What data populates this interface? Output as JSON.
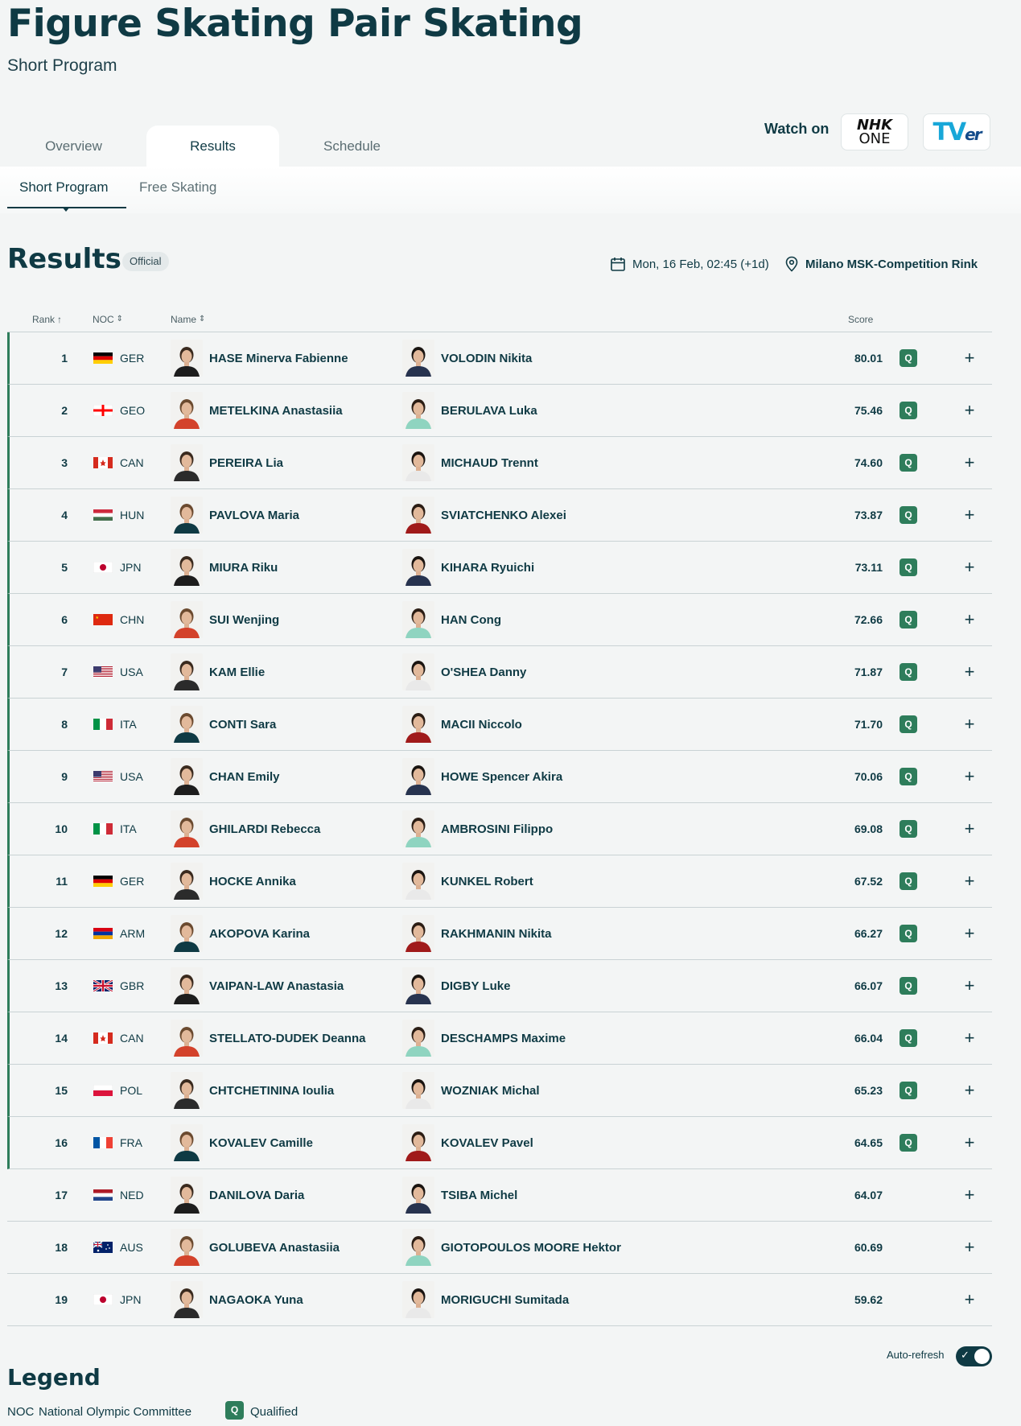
{
  "header": {
    "title": "Figure Skating Pair Skating",
    "subtitle": "Short Program"
  },
  "tabs": [
    {
      "label": "Overview"
    },
    {
      "label": "Results"
    },
    {
      "label": "Schedule"
    }
  ],
  "watch": {
    "label": "Watch on",
    "providers": [
      {
        "line1": "NHK",
        "line2": "ONE"
      },
      {
        "brand": "TV",
        "suffix": "er"
      }
    ]
  },
  "subtabs": [
    {
      "label": "Short Program"
    },
    {
      "label": "Free Skating"
    }
  ],
  "results": {
    "heading": "Results",
    "badge": "Official",
    "datetime": "Mon, 16 Feb, 02:45 (+1d)",
    "venue": "Milano MSK-Competition Rink"
  },
  "columns": {
    "rank": "Rank",
    "noc": "NOC",
    "name": "Name",
    "score": "Score"
  },
  "rows": [
    {
      "rank": "1",
      "noc": "GER",
      "skater1": "HASE Minerva Fabienne",
      "skater2": "VOLODIN Nikita",
      "score": "80.01",
      "q": "Q"
    },
    {
      "rank": "2",
      "noc": "GEO",
      "skater1": "METELKINA Anastasiia",
      "skater2": "BERULAVA Luka",
      "score": "75.46",
      "q": "Q"
    },
    {
      "rank": "3",
      "noc": "CAN",
      "skater1": "PEREIRA Lia",
      "skater2": "MICHAUD Trennt",
      "score": "74.60",
      "q": "Q"
    },
    {
      "rank": "4",
      "noc": "HUN",
      "skater1": "PAVLOVA Maria",
      "skater2": "SVIATCHENKO Alexei",
      "score": "73.87",
      "q": "Q"
    },
    {
      "rank": "5",
      "noc": "JPN",
      "skater1": "MIURA Riku",
      "skater2": "KIHARA Ryuichi",
      "score": "73.11",
      "q": "Q"
    },
    {
      "rank": "6",
      "noc": "CHN",
      "skater1": "SUI Wenjing",
      "skater2": "HAN Cong",
      "score": "72.66",
      "q": "Q"
    },
    {
      "rank": "7",
      "noc": "USA",
      "skater1": "KAM Ellie",
      "skater2": "O'SHEA Danny",
      "score": "71.87",
      "q": "Q"
    },
    {
      "rank": "8",
      "noc": "ITA",
      "skater1": "CONTI Sara",
      "skater2": "MACII Niccolo",
      "score": "71.70",
      "q": "Q"
    },
    {
      "rank": "9",
      "noc": "USA",
      "skater1": "CHAN Emily",
      "skater2": "HOWE Spencer Akira",
      "score": "70.06",
      "q": "Q"
    },
    {
      "rank": "10",
      "noc": "ITA",
      "skater1": "GHILARDI Rebecca",
      "skater2": "AMBROSINI Filippo",
      "score": "69.08",
      "q": "Q"
    },
    {
      "rank": "11",
      "noc": "GER",
      "skater1": "HOCKE Annika",
      "skater2": "KUNKEL Robert",
      "score": "67.52",
      "q": "Q"
    },
    {
      "rank": "12",
      "noc": "ARM",
      "skater1": "AKOPOVA Karina",
      "skater2": "RAKHMANIN Nikita",
      "score": "66.27",
      "q": "Q"
    },
    {
      "rank": "13",
      "noc": "GBR",
      "skater1": "VAIPAN-LAW Anastasia",
      "skater2": "DIGBY Luke",
      "score": "66.07",
      "q": "Q"
    },
    {
      "rank": "14",
      "noc": "CAN",
      "skater1": "STELLATO-DUDEK Deanna",
      "skater2": "DESCHAMPS Maxime",
      "score": "66.04",
      "q": "Q"
    },
    {
      "rank": "15",
      "noc": "POL",
      "skater1": "CHTCHETININA Ioulia",
      "skater2": "WOZNIAK Michal",
      "score": "65.23",
      "q": "Q"
    },
    {
      "rank": "16",
      "noc": "FRA",
      "skater1": "KOVALEV Camille",
      "skater2": "KOVALEV Pavel",
      "score": "64.65",
      "q": "Q"
    },
    {
      "rank": "17",
      "noc": "NED",
      "skater1": "DANILOVA Daria",
      "skater2": "TSIBA Michel",
      "score": "64.07",
      "q": ""
    },
    {
      "rank": "18",
      "noc": "AUS",
      "skater1": "GOLUBEVA Anastasiia",
      "skater2": "GIOTOPOULOS MOORE Hektor",
      "score": "60.69",
      "q": ""
    },
    {
      "rank": "19",
      "noc": "JPN",
      "skater1": "NAGAOKA Yuna",
      "skater2": "MORIGUCHI Sumitada",
      "score": "59.62",
      "q": ""
    }
  ],
  "auto_refresh": {
    "label": "Auto-refresh",
    "enabled": true
  },
  "legend": {
    "heading": "Legend",
    "noc_abbr": "NOC",
    "noc_text": "National Olympic Committee",
    "q_abbr": "Q",
    "q_text": "Qualified"
  },
  "colors": {
    "primary": "#0f3a44",
    "qualified": "#2e7d5b",
    "background": "#f3f5f5"
  }
}
